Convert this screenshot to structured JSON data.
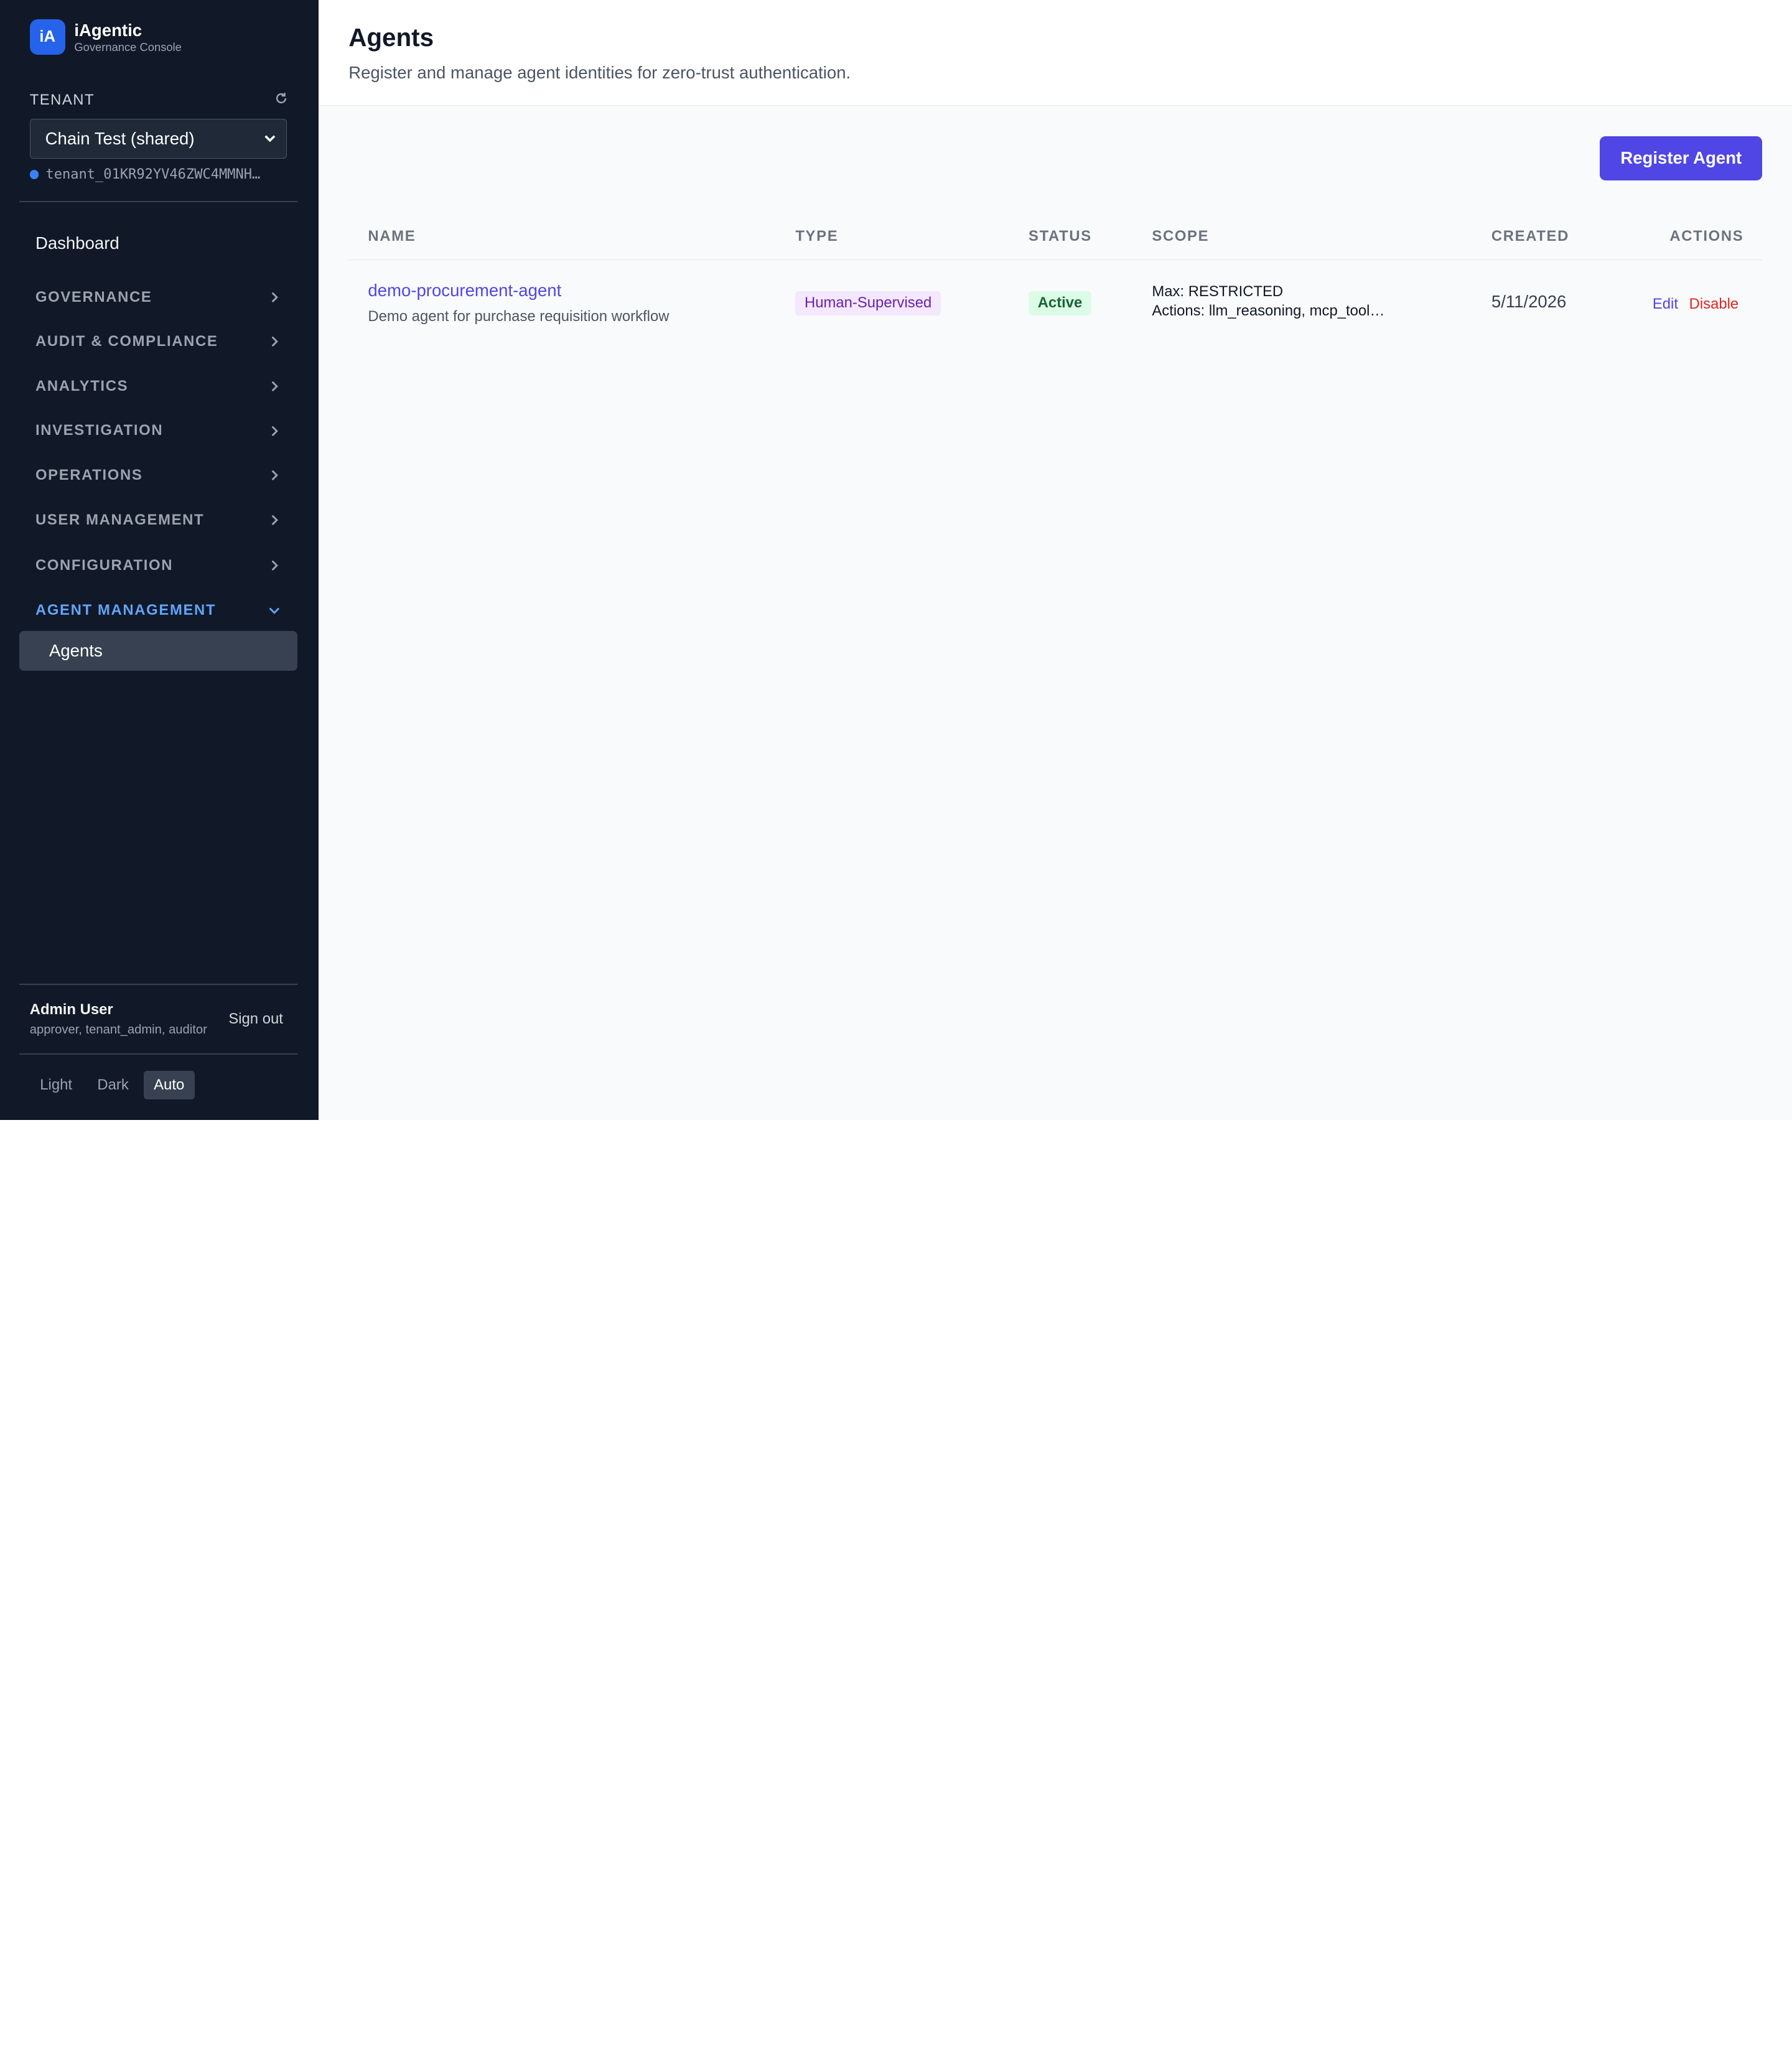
{
  "brand": {
    "logo_text": "iA",
    "name": "iAgentic",
    "subtitle": "Governance Console"
  },
  "tenant": {
    "label": "TENANT",
    "selected": "Chain Test (shared)",
    "id": "tenant_01KR92YV46ZWC4MMNH…"
  },
  "nav": {
    "dashboard": "Dashboard",
    "sections": [
      {
        "label": "GOVERNANCE",
        "expanded": false
      },
      {
        "label": "AUDIT & COMPLIANCE",
        "expanded": false
      },
      {
        "label": "ANALYTICS",
        "expanded": false
      },
      {
        "label": "INVESTIGATION",
        "expanded": false
      },
      {
        "label": "OPERATIONS",
        "expanded": false
      },
      {
        "label": "USER MANAGEMENT",
        "expanded": false
      },
      {
        "label": "CONFIGURATION",
        "expanded": false
      },
      {
        "label": "AGENT MANAGEMENT",
        "expanded": true
      }
    ],
    "active_item": "Agents"
  },
  "user": {
    "name": "Admin User",
    "roles": "approver, tenant_admin, auditor",
    "sign_out": "Sign out"
  },
  "theme": {
    "options": [
      "Light",
      "Dark",
      "Auto"
    ],
    "selected": "Auto"
  },
  "page": {
    "title": "Agents",
    "subtitle": "Register and manage agent identities for zero-trust authentication.",
    "register_button": "Register Agent"
  },
  "table": {
    "columns": [
      "NAME",
      "TYPE",
      "STATUS",
      "SCOPE",
      "CREATED",
      "ACTIONS"
    ],
    "rows": [
      {
        "name": "demo-procurement-agent",
        "description": "Demo agent for purchase requisition workflow",
        "type": "Human-Supervised",
        "status": "Active",
        "scope_max": "Max: RESTRICTED",
        "scope_actions": "Actions: llm_reasoning, mcp_tool…",
        "created": "5/11/2026",
        "edit": "Edit",
        "disable": "Disable"
      }
    ]
  },
  "colors": {
    "sidebar_bg": "#111827",
    "accent": "#4f46e5",
    "active_section": "#60a5fa",
    "danger": "#dc2626",
    "success": "#166534"
  }
}
